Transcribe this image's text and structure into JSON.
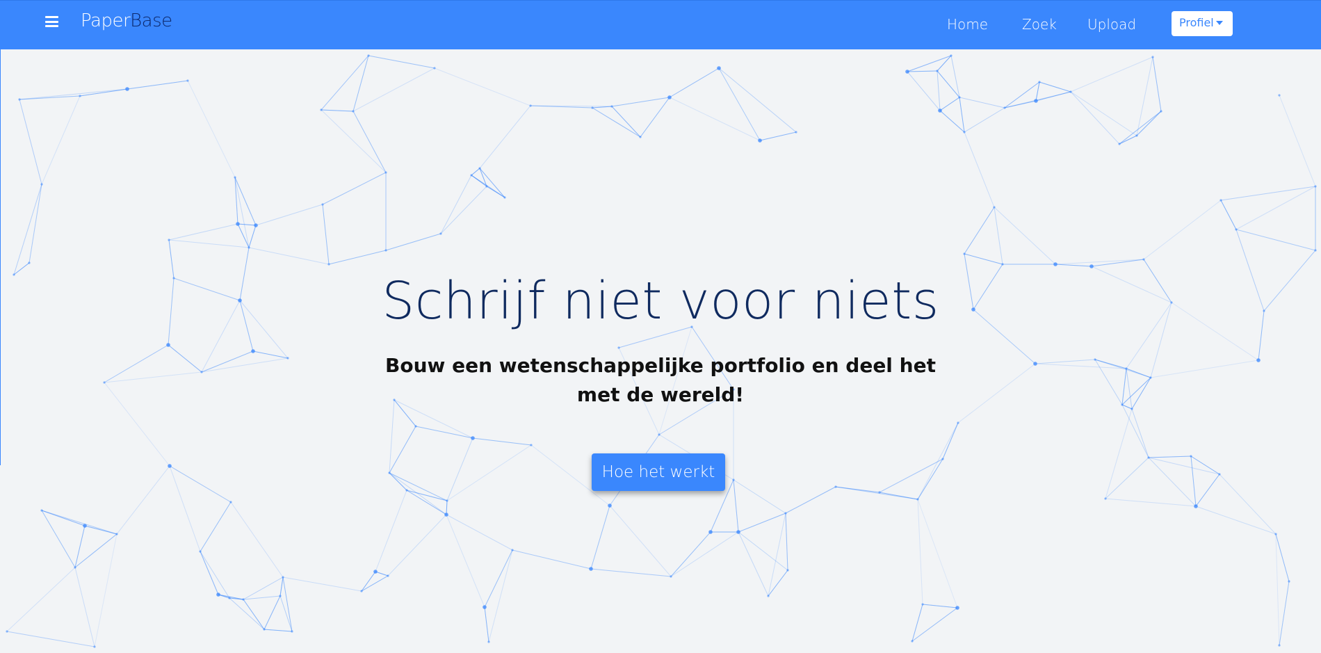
{
  "navbar": {
    "brand_part1": "Paper",
    "brand_part2": "Base",
    "links": [
      "Home",
      "Zoek",
      "Upload"
    ],
    "profile_label": "Profiel",
    "color": "#3a87fd"
  },
  "hero": {
    "title": "Schrijf niet voor niets",
    "subtitle": "Bouw een wetenschappelijke portfolio en deel het met de wereld!",
    "cta_label": "Hoe het werkt"
  },
  "colors": {
    "accent": "#3a87fd",
    "background": "#f2f4f6",
    "title": "#0f2a5f"
  }
}
